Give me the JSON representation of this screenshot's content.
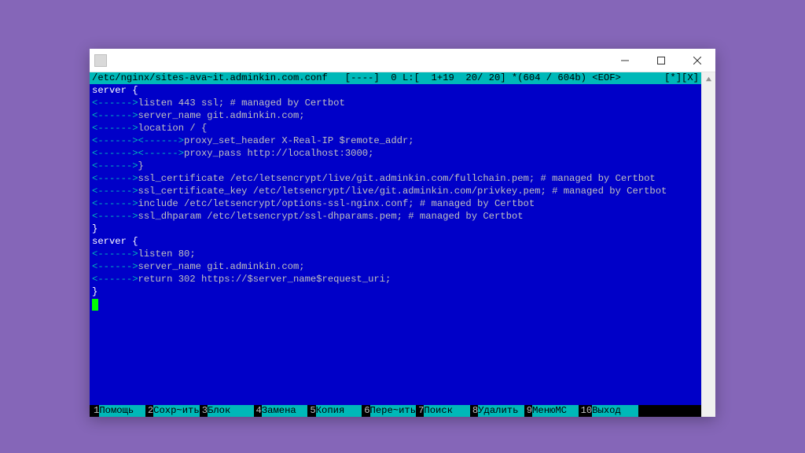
{
  "window": {
    "title": " ",
    "controls": {
      "min": "minimize",
      "max": "maximize",
      "close": "close"
    }
  },
  "status": {
    "left": "/etc/nginx/sites-ava~it.adminkin.com.conf   [----]  0 L:[  1+19  20/ 20] *(604 / 604b) <EOF>",
    "right": "[*][X]"
  },
  "editor": {
    "arrow_open": "<------>",
    "arrow_close": ">",
    "lines": [
      {
        "i": "",
        "t": "server {",
        "c": "kw-white"
      },
      {
        "i": "1",
        "t": "listen 443 ssl; # managed by Certbot"
      },
      {
        "i": "1",
        "t": "server_name git.adminkin.com;"
      },
      {
        "i": "",
        "t": ""
      },
      {
        "i": "1",
        "t": "location / {"
      },
      {
        "i": "2",
        "t": "proxy_set_header X-Real-IP $remote_addr;"
      },
      {
        "i": "2",
        "t": "proxy_pass http://localhost:3000;"
      },
      {
        "i": "1",
        "t": "}"
      },
      {
        "i": "",
        "t": ""
      },
      {
        "i": "1",
        "t": "ssl_certificate /etc/letsencrypt/live/git.adminkin.com/fullchain.pem; # managed by Certbot"
      },
      {
        "i": "1",
        "t": "ssl_certificate_key /etc/letsencrypt/live/git.adminkin.com/privkey.pem; # managed by Certbot"
      },
      {
        "i": "1",
        "t": "include /etc/letsencrypt/options-ssl-nginx.conf; # managed by Certbot"
      },
      {
        "i": "1",
        "t": "ssl_dhparam /etc/letsencrypt/ssl-dhparams.pem; # managed by Certbot"
      },
      {
        "i": "",
        "t": "}",
        "c": "kw-white"
      },
      {
        "i": "",
        "t": "server {",
        "c": "kw-white"
      },
      {
        "i": "1",
        "t": "listen 80;"
      },
      {
        "i": "1",
        "t": "server_name git.adminkin.com;"
      },
      {
        "i": "1",
        "t": "return 302 https://$server_name$request_uri;"
      },
      {
        "i": "",
        "t": "}",
        "c": "kw-white"
      }
    ]
  },
  "fkeys": [
    {
      "n": "1",
      "label": "Помощь"
    },
    {
      "n": "2",
      "label": "Сохр~ить"
    },
    {
      "n": "3",
      "label": "Блок"
    },
    {
      "n": "4",
      "label": "Замена"
    },
    {
      "n": "5",
      "label": "Копия"
    },
    {
      "n": "6",
      "label": "Пере~ить"
    },
    {
      "n": "7",
      "label": "Поиск"
    },
    {
      "n": "8",
      "label": "Удалить"
    },
    {
      "n": "9",
      "label": "МенюMC"
    },
    {
      "n": "10",
      "label": "Выход"
    }
  ]
}
